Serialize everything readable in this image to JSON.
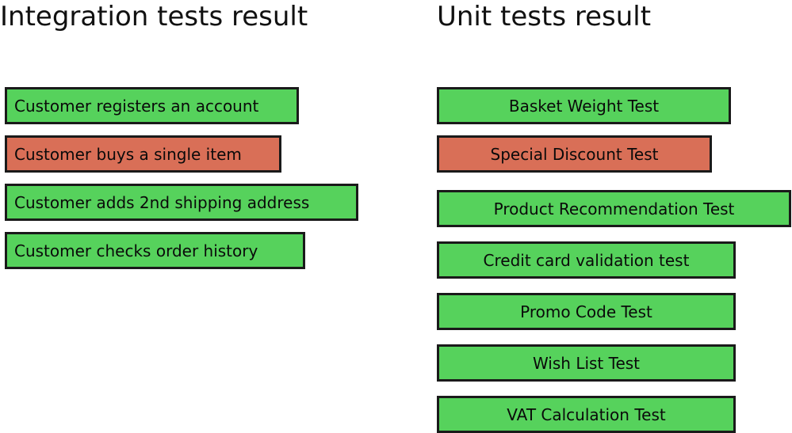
{
  "colors": {
    "pass": "#56d25c",
    "fail": "#d96f57",
    "border": "#1a1a1a",
    "text": "#0a0a0a",
    "background": "#ffffff"
  },
  "columns": [
    {
      "id": "integration",
      "title": "Integration tests result",
      "align": "left",
      "tests": [
        {
          "label": "Customer registers an account",
          "status": "pass"
        },
        {
          "label": "Customer buys a single item",
          "status": "fail"
        },
        {
          "label": "Customer adds 2nd shipping address",
          "status": "pass"
        },
        {
          "label": "Customer checks order history",
          "status": "pass"
        }
      ]
    },
    {
      "id": "unit",
      "title": "Unit tests result",
      "align": "center",
      "tests": [
        {
          "label": "Basket Weight Test",
          "status": "pass"
        },
        {
          "label": "Special Discount Test",
          "status": "fail"
        },
        {
          "label": "Product Recommendation Test",
          "status": "pass"
        },
        {
          "label": "Credit card validation test",
          "status": "pass"
        },
        {
          "label": "Promo Code Test",
          "status": "pass"
        },
        {
          "label": "Wish List Test",
          "status": "pass"
        },
        {
          "label": "VAT Calculation Test",
          "status": "pass"
        }
      ]
    }
  ]
}
